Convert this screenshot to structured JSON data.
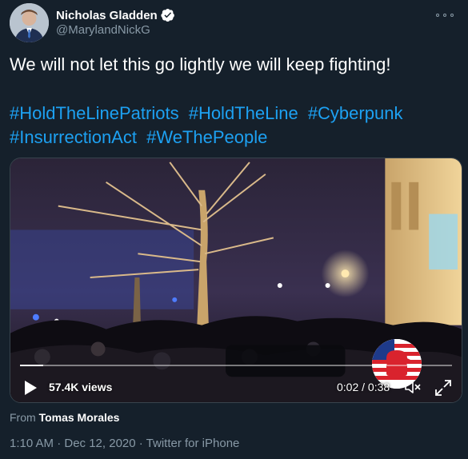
{
  "author": {
    "name": "Nicholas Gladden",
    "handle": "@MarylandNickG",
    "verified": true,
    "avatar_icon": "profile-photo"
  },
  "tweet": {
    "text": "We will not let this go lightly we will keep fighting!",
    "hashtags": [
      "#HoldTheLinePatriots",
      "#HoldTheLine",
      "#Cyberpunk",
      "#InsurrectionAct",
      "#WeThePeople"
    ]
  },
  "video": {
    "views": "57.4K views",
    "time": "0:02 / 0:38",
    "progress": 0.053,
    "play_icon": "play-icon",
    "volume_icon": "volume-muted-icon",
    "expand_icon": "expand-icon"
  },
  "source": {
    "prefix": "From",
    "name": "Tomas Morales"
  },
  "meta": {
    "timestamp": "1:10 AM · Dec 12, 2020 · Twitter for iPhone"
  },
  "colors": {
    "background": "#15202b",
    "link": "#1da1f2",
    "secondary_text": "#8899a6",
    "verified": "#ffffff"
  }
}
